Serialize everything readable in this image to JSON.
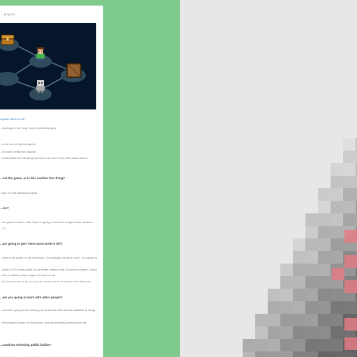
{
  "document": {
    "top_label": "...projects",
    "lines": [
      {
        "text": "a game demo is out",
        "style": "link"
      },
      {
        "text": "...working on the thing. And it's still early days.",
        "style": "normal"
      },
      {
        "text": "...to be one of my first games",
        "style": "normal"
      },
      {
        "text": "...but didn't finish the original",
        "style": "normal"
      },
      {
        "text": "...understand the following (someone will need?) the first reason will be",
        "style": "normal"
      },
      {
        "text": "...out the game, or is this another free thing?",
        "style": "heading"
      },
      {
        "text": "...like my first released project.",
        "style": "normal"
      },
      {
        "text": "...me?",
        "style": "heading"
      },
      {
        "text": "...the game is faster. After that, I'm going to add new things and/or releases",
        "style": "normal"
      },
      {
        "text": "...12.",
        "style": "normal"
      },
      {
        "text": "...are going to get? How much work is left?",
        "style": "heading"
      },
      {
        "text": "...here is the game. In the final build, I'm hoping to do six or more. So expect to",
        "style": "normal"
      },
      {
        "text": "...have a LOT more polish, much better balance and a lot more content. Once I",
        "style": "normal"
      },
      {
        "text": "...the on making these engine for them so far.",
        "style": "normal"
      },
      {
        "text": "...the third month or so, so you can expect the final release later this year!",
        "style": "muted"
      },
      {
        "text": "...are you going to work with other people?",
        "style": "heading"
      },
      {
        "text": "...and were going to be cleaning up as well as write and be available to doing",
        "style": "normal"
      },
      {
        "text": "...the prospect some art that works, and am currently searching for the",
        "style": "normal"
      },
      {
        "text": "...continue releasing public builds?",
        "style": "heading"
      },
      {
        "text": "...(optimized), as a private goal to enable some for new releasing parts of the",
        "style": "normal"
      }
    ]
  },
  "hero": {
    "alt": "game-node-map",
    "colors": {
      "background": "#06162a",
      "node": "#2f4b5c",
      "edge": "#4f7383"
    }
  },
  "colors": {
    "page_background": "#7fcb8c",
    "panel": "#ffffff",
    "link": "#2f7bc4",
    "pixel_background": "#e7e7e7",
    "pixel_accent": "#e37b84"
  }
}
